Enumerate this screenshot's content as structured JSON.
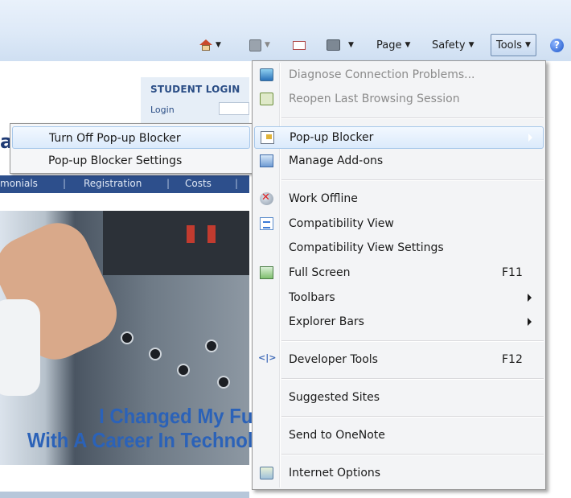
{
  "commandbar": {
    "page_label": "Page",
    "safety_label": "Safety",
    "tools_label": "Tools",
    "help_glyph": "?",
    "icons": [
      "home-icon",
      "feeds-icon",
      "read-mail-icon",
      "print-icon",
      "help-icon"
    ]
  },
  "page": {
    "student_login": "STUDENT LOGIN",
    "login_label": "Login",
    "big_letter": "a",
    "nav": [
      "monials",
      "Registration",
      "Costs"
    ],
    "slogan_line1": "I Changed My Fu",
    "slogan_line2": "With A Career In Technol"
  },
  "submenu": {
    "items": [
      {
        "label": "Turn Off Pop-up Blocker"
      },
      {
        "label": "Pop-up Blocker Settings"
      }
    ]
  },
  "tools_menu": {
    "items": [
      {
        "label": "Diagnose Connection Problems...",
        "icon": "diagnose-connection-icon",
        "disabled": true
      },
      {
        "label": "Reopen Last Browsing Session",
        "icon": "reopen-session-icon",
        "disabled": true
      },
      {
        "label": "Pop-up Blocker",
        "icon": "popup-blocker-icon",
        "submenu": true,
        "highlighted": true
      },
      {
        "label": "Manage Add-ons",
        "icon": "manage-addons-icon"
      },
      {
        "label": "Work Offline",
        "icon": "work-offline-icon"
      },
      {
        "label": "Compatibility View",
        "icon": "compatibility-view-icon"
      },
      {
        "label": "Compatibility View Settings"
      },
      {
        "label": "Full Screen",
        "icon": "full-screen-icon",
        "shortcut": "F11"
      },
      {
        "label": "Toolbars",
        "submenu": true
      },
      {
        "label": "Explorer Bars",
        "submenu": true
      },
      {
        "label": "Developer Tools",
        "icon": "developer-tools-icon",
        "shortcut": "F12"
      },
      {
        "label": "Suggested Sites"
      },
      {
        "label": "Send to OneNote"
      },
      {
        "label": "Internet Options",
        "icon": "internet-options-icon"
      }
    ]
  }
}
